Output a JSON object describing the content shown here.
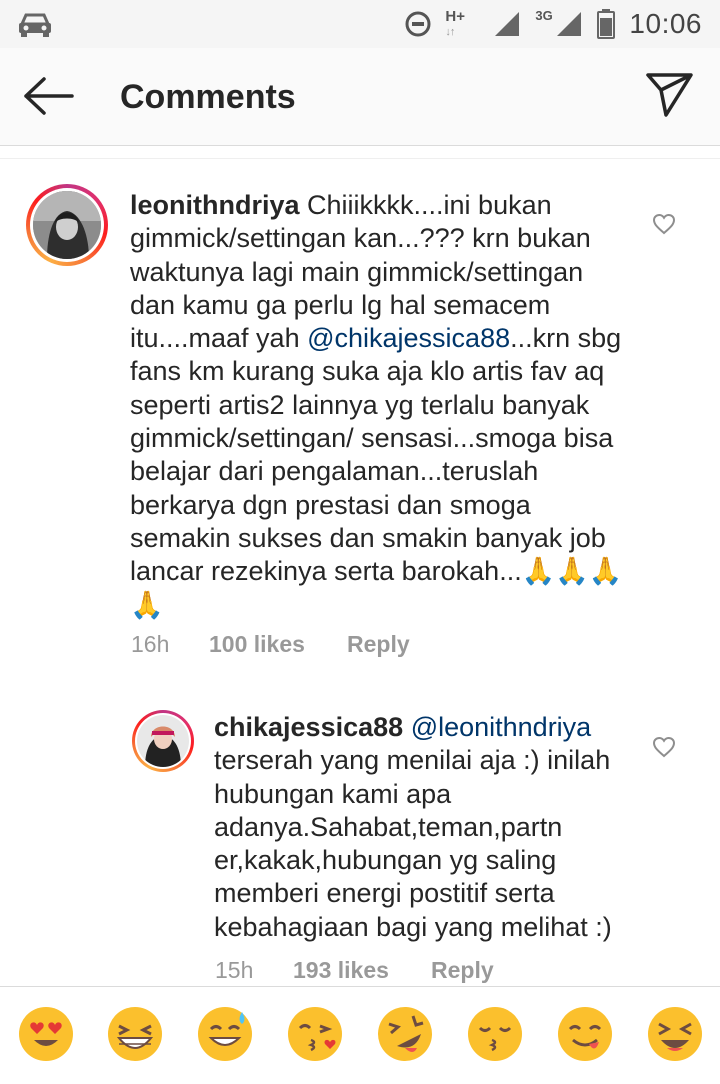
{
  "status_bar": {
    "network1_label": "H+",
    "network1_arrows": "↓↑",
    "network2_label": "3G",
    "time": "10:06"
  },
  "header": {
    "title": "Comments"
  },
  "comments": [
    {
      "username": "leonithndriya",
      "text_before_mention": "Chiiikkkk....ini bukan gimmick/settingan kan...??? krn bukan waktunya lagi main gimmick/settingan dan kamu ga perlu lg hal semacem itu....maaf yah ",
      "mention": "@chikajessica88",
      "text_after_mention": "...krn sbg fans km kurang suka aja klo artis fav aq seperti artis2 lainnya yg terlalu banyak gimmick/settingan/ sensasi...smoga bisa belajar dari pengalaman...teruslah berkarya dgn prestasi dan smoga semakin sukses dan smakin banyak job lancar rezekinya serta barokah...🙏🙏🙏🙏",
      "time": "16h",
      "likes": "100 likes",
      "reply_label": "Reply"
    },
    {
      "username": "chikajessica88",
      "mention": "@leonithndriya",
      "text": "terserah yang menilai aja :) inilah hubungan kami apa adanya.Sahabat,teman,partn er,kakak,hubungan yg saling memberi energi postitif serta kebahagiaan bagi yang melihat :)",
      "time": "15h",
      "likes": "193 likes",
      "reply_label": "Reply"
    }
  ],
  "emoji_bar": [
    "heart-eyes-emoji",
    "grinning-squint-emoji",
    "sweat-smile-emoji",
    "kissing-heart-emoji",
    "squinting-tongue-emoji",
    "kissing-smiling-eyes-emoji",
    "savoring-food-emoji",
    "laughing-emoji"
  ],
  "colors": {
    "mention": "#003569",
    "meta": "#999999",
    "emoji_yellow": "#fbc02d"
  }
}
